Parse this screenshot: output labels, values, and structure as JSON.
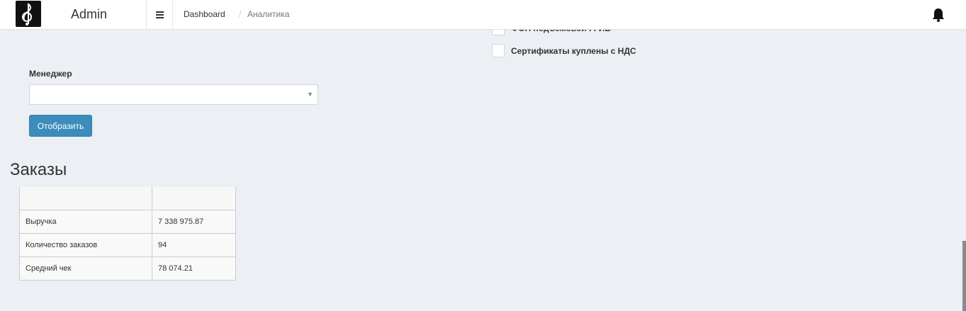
{
  "header": {
    "brand": "Admin",
    "breadcrumb": {
      "home": "Dashboard",
      "separator": "/",
      "current": "Аналитика"
    }
  },
  "filters": {
    "checkbox_partial": {
      "label": "ФОП подъемовой ГГИБ"
    },
    "checkbox_vat": {
      "label": "Сертификаты куплены с НДС"
    },
    "manager": {
      "label": "Менеджер",
      "value": ""
    },
    "submit_label": "Отобразить"
  },
  "orders": {
    "title": "Заказы",
    "header": [
      "",
      ""
    ],
    "rows": [
      {
        "label": "Выручка",
        "value": "7 338 975.87"
      },
      {
        "label": "Количество заказов",
        "value": "94"
      },
      {
        "label": "Средний чек",
        "value": "78 074.21"
      }
    ]
  },
  "colors": {
    "accent": "#3c8dbc",
    "background": "#eceff4",
    "header_bg": "#ffffff"
  },
  "icons": {
    "logo": "treble-clef-icon",
    "menu": "hamburger-icon",
    "notifications": "bell-icon"
  }
}
